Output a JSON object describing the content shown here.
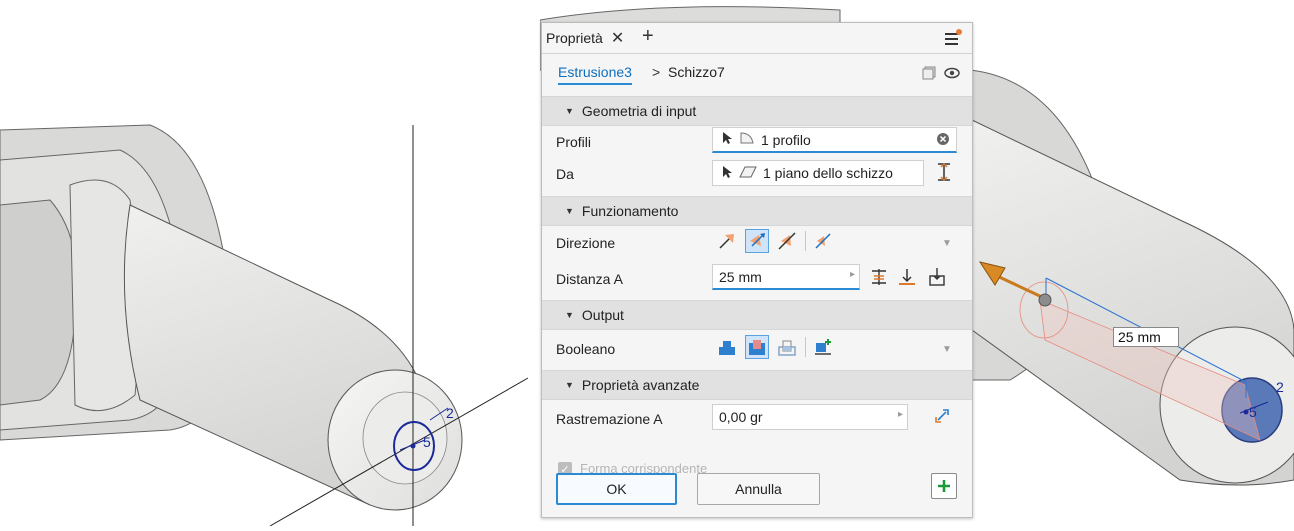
{
  "panel": {
    "tab_label": "Proprietà",
    "breadcrumb": {
      "feature": "Estrusione3",
      "separator": ">",
      "sketch": "Schizzo7"
    },
    "sections": {
      "input": "Geometria di input",
      "behavior": "Funzionamento",
      "output": "Output",
      "advanced": "Proprietà avanzate"
    },
    "input": {
      "profiles_label": "Profili",
      "profiles_value": "1 profilo",
      "from_label": "Da",
      "from_value": "1 piano dello schizzo"
    },
    "behavior": {
      "direction_label": "Direzione",
      "distance_label": "Distanza A",
      "distance_value": "25 mm"
    },
    "output": {
      "boolean_label": "Booleano"
    },
    "advanced": {
      "taper_label": "Rastremazione A",
      "taper_value": "0,00 gr",
      "match_shape_label": "Forma corrispondente"
    },
    "buttons": {
      "ok": "OK",
      "cancel": "Annulla"
    }
  },
  "viewport": {
    "left_sketch_labels": {
      "dim_small": "2",
      "dim_dia": "5"
    },
    "right_dimension": "25 mm",
    "right_sketch_labels": {
      "dim_small": "2",
      "dim_dia": "5"
    }
  },
  "colors": {
    "accent": "#2a8ad4",
    "preview_orange": "#e07a2b",
    "sketch_blue": "#1a2a9a"
  }
}
